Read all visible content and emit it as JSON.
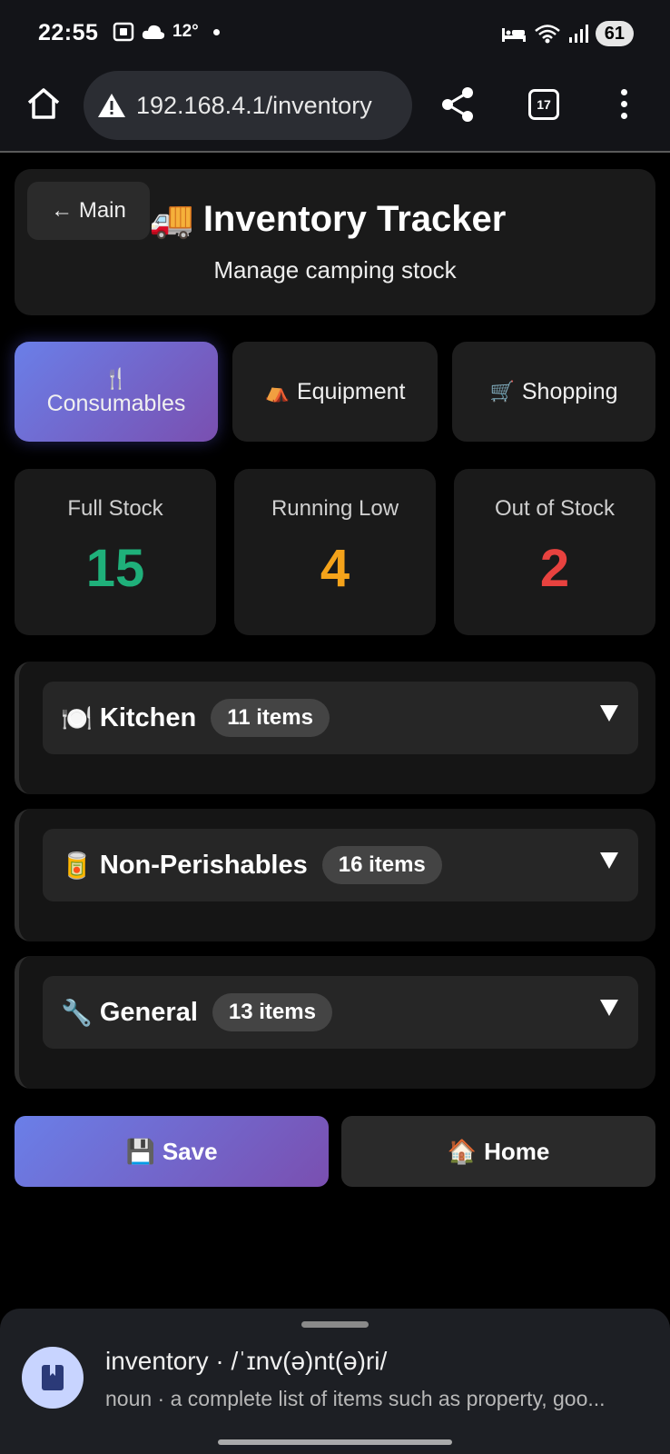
{
  "status_bar": {
    "time": "22:55",
    "weather": "12°",
    "battery": "61"
  },
  "browser": {
    "url": "192.168.4.1/inventory",
    "tab_count": "17"
  },
  "header": {
    "back_label": "← Main",
    "icon": "🚚",
    "title": "Inventory Tracker",
    "subtitle": "Manage camping stock"
  },
  "tabs": [
    {
      "icon": "🍴",
      "label": "Consumables",
      "active": true
    },
    {
      "icon": "⛺",
      "label": "Equipment",
      "active": false
    },
    {
      "icon": "🛒",
      "label": "Shopping",
      "active": false
    }
  ],
  "stats": [
    {
      "label": "Full Stock",
      "value": "15",
      "color": "#1fb07a"
    },
    {
      "label": "Running Low",
      "value": "4",
      "color": "#f5a31a"
    },
    {
      "label": "Out of Stock",
      "value": "2",
      "color": "#e8423f"
    }
  ],
  "categories": [
    {
      "icon": "🍽️",
      "name": "Kitchen",
      "count": "11 items"
    },
    {
      "icon": "🥫",
      "name": "Non-Perishables",
      "count": "16 items"
    },
    {
      "icon": "🔧",
      "name": "General",
      "count": "13 items"
    }
  ],
  "actions": {
    "save_icon": "💾",
    "save_label": "Save",
    "home_icon": "🏠",
    "home_label": "Home"
  },
  "definition": {
    "word": "inventory · /ˈɪnv(ə)nt(ə)ri/",
    "text": "noun · a complete list of items such as property, goo..."
  }
}
